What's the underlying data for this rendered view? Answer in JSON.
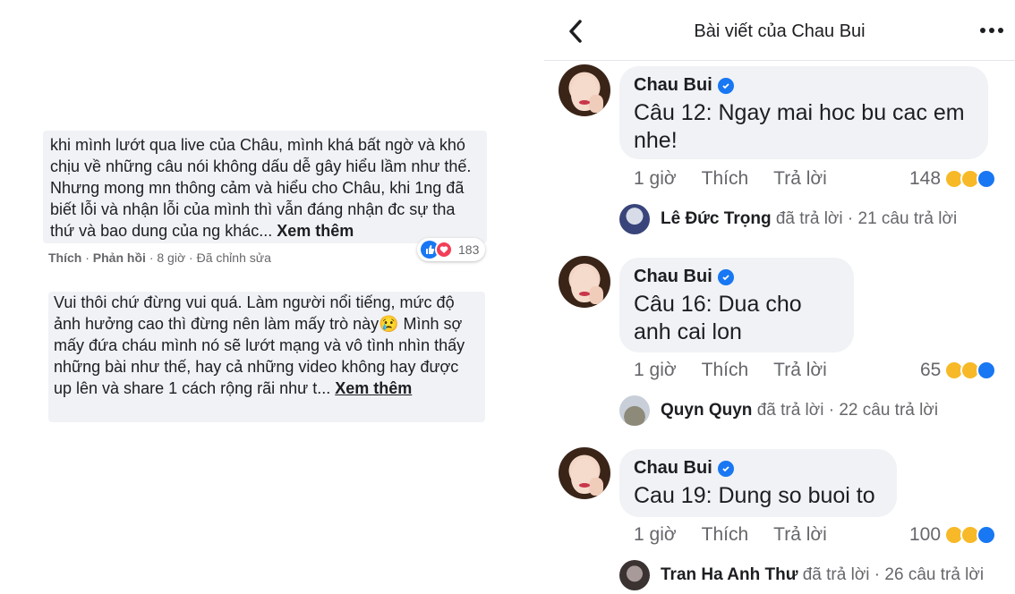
{
  "left": {
    "comment1": {
      "text": "khi mình lướt qua live của Châu, mình khá bất ngờ và khó chịu về những câu nói không dấu dễ gây hiểu lầm như thế. Nhưng mong mn thông cảm và hiểu cho Châu, khi 1ng đã biết lỗi và nhận lỗi của mình thì vẫn đáng nhận đc sự tha thứ và bao dung của ng khác...",
      "see_more": "Xem thêm",
      "like": "Thích",
      "reply": "Phản hồi",
      "time": "8 giờ",
      "edited": "Đã chỉnh sửa",
      "reactions": "183"
    },
    "comment2": {
      "text": "Vui thôi chứ đừng vui quá. Làm người nổi tiếng, mức độ ảnh hưởng cao thì đừng nên làm mấy trò này😢 Mình sợ mấy đứa cháu mình nó sẽ lướt mạng và vô tình nhìn thấy những bài như thế, hay cả những video không hay được up lên và share 1 cách rộng rãi như t...",
      "see_more": "Xem thêm"
    }
  },
  "right": {
    "header": {
      "title": "Bài viết của Chau Bui"
    },
    "comments": [
      {
        "author": "Chau Bui",
        "text": "Câu 12: Ngay mai hoc bu cac em nhe!",
        "time": "1 giờ",
        "like": "Thích",
        "reply": "Trả lời",
        "count": "148",
        "replier": "Lê Đức Trọng",
        "replied": "đã trả lời",
        "reply_count": "· 21 câu trả lời"
      },
      {
        "author": "Chau Bui",
        "text": "Câu 16: Dua cho anh cai lon",
        "time": "1 giờ",
        "like": "Thích",
        "reply": "Trả lời",
        "count": "65",
        "replier": "Quyn Quyn",
        "replied": "đã trả lời",
        "reply_count": "· 22 câu trả lời"
      },
      {
        "author": "Chau Bui",
        "text": "Cau 19: Dung so buoi to",
        "time": "1 giờ",
        "like": "Thích",
        "reply": "Trả lời",
        "count": "100",
        "replier": "Tran Ha Anh Thư",
        "replied": "đã trả lời",
        "reply_count": "· 26 câu trả lời"
      }
    ]
  },
  "colors": {
    "accent": "#1877f2",
    "bubble": "#f0f2f5",
    "muted": "#65676b"
  }
}
